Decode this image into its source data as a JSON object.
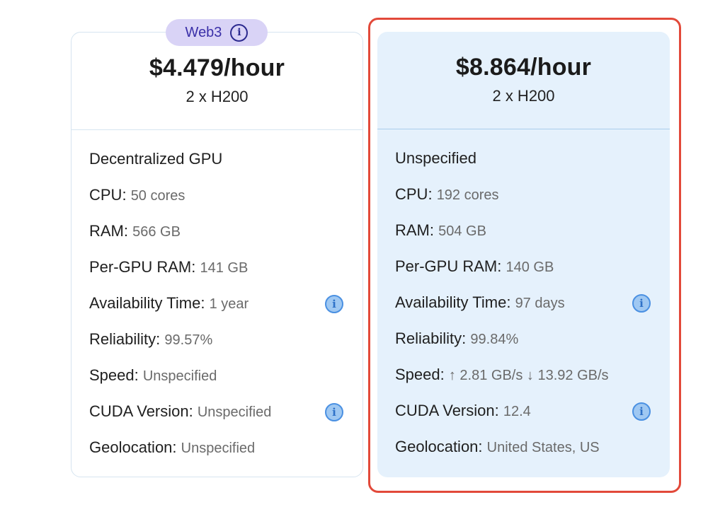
{
  "offers": [
    {
      "badge": {
        "label": "Web3",
        "icon": "info-icon"
      },
      "price": "$4.479/hour",
      "gpu": "2 x H200",
      "provider": "Decentralized GPU",
      "specs": [
        {
          "label": "CPU:",
          "value": "50 cores",
          "info": false
        },
        {
          "label": "RAM:",
          "value": "566 GB",
          "info": false
        },
        {
          "label": "Per-GPU RAM:",
          "value": "141 GB",
          "info": false
        },
        {
          "label": "Availability Time:",
          "value": "1 year",
          "info": true
        },
        {
          "label": "Reliability:",
          "value": "99.57%",
          "info": false
        },
        {
          "label": "Speed:",
          "value": "Unspecified",
          "info": false
        },
        {
          "label": "CUDA Version:",
          "value": "Unspecified",
          "info": true
        },
        {
          "label": "Geolocation:",
          "value": "Unspecified",
          "info": false
        }
      ]
    },
    {
      "selected": true,
      "price": "$8.864/hour",
      "gpu": "2 x H200",
      "provider": "Unspecified",
      "specs": [
        {
          "label": "CPU:",
          "value": "192 cores",
          "info": false
        },
        {
          "label": "RAM:",
          "value": "504 GB",
          "info": false
        },
        {
          "label": "Per-GPU RAM:",
          "value": "140 GB",
          "info": false
        },
        {
          "label": "Availability Time:",
          "value": "97 days",
          "info": true
        },
        {
          "label": "Reliability:",
          "value": "99.84%",
          "info": false
        },
        {
          "label": "Speed:",
          "value": "↑ 2.81 GB/s ↓ 13.92 GB/s",
          "info": false
        },
        {
          "label": "CUDA Version:",
          "value": "12.4",
          "info": true
        },
        {
          "label": "Geolocation:",
          "value": "United States, US",
          "info": false
        }
      ]
    }
  ],
  "colors": {
    "selection_ring": "#e2493a",
    "selected_card_bg": "#e5f1fc",
    "badge_bg": "#d9d3f6",
    "info_icon": "#4a90e2"
  }
}
